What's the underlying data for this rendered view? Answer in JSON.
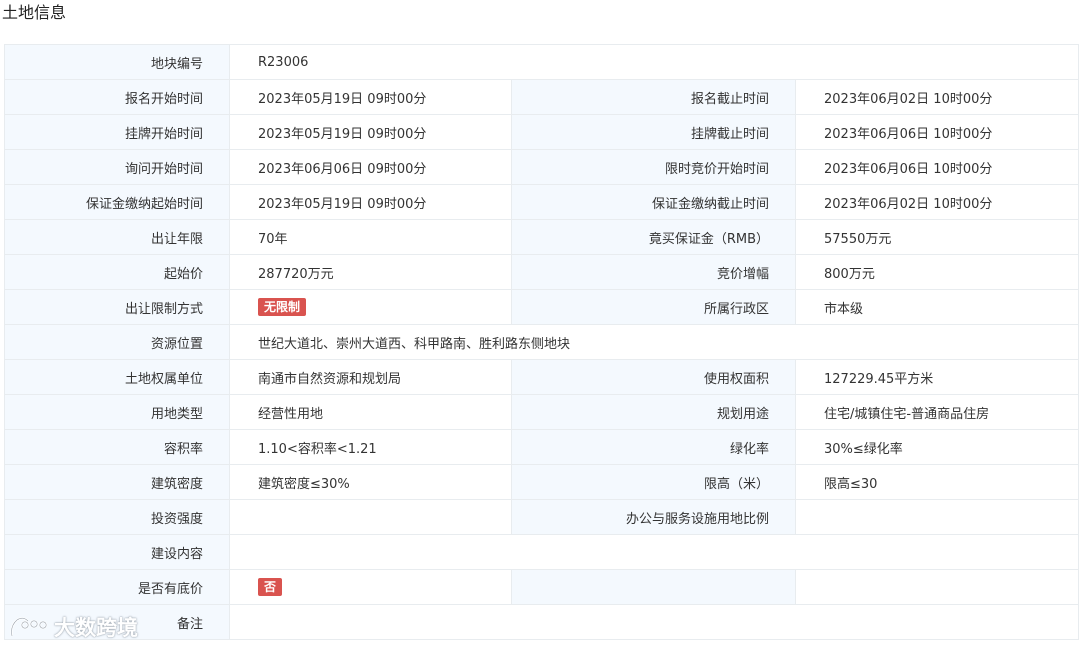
{
  "page": {
    "title": "土地信息"
  },
  "rows": [
    {
      "l1": "地块编号",
      "v1": "R23006"
    },
    {
      "l1": "报名开始时间",
      "v1": "2023年05月19日 09时00分",
      "l2": "报名截止时间",
      "v2": "2023年06月02日 10时00分"
    },
    {
      "l1": "挂牌开始时间",
      "v1": "2023年05月19日 09时00分",
      "l2": "挂牌截止时间",
      "v2": "2023年06月06日 10时00分"
    },
    {
      "l1": "询问开始时间",
      "v1": "2023年06月06日 09时00分",
      "l2": "限时竞价开始时间",
      "v2": "2023年06月06日 10时00分"
    },
    {
      "l1": "保证金缴纳起始时间",
      "v1": "2023年05月19日 09时00分",
      "l2": "保证金缴纳截止时间",
      "v2": "2023年06月02日 10时00分"
    },
    {
      "l1": "出让年限",
      "v1": "70年",
      "l2": "竟买保证金（RMB）",
      "v2": "57550万元"
    },
    {
      "l1": "起始价",
      "v1": "287720万元",
      "l2": "竞价增幅",
      "v2": "800万元"
    },
    {
      "l1": "出让限制方式",
      "v1": "无限制",
      "l2": "所属行政区",
      "v2": "市本级"
    },
    {
      "l1": "资源位置",
      "v1": "世纪大道北、崇州大道西、科甲路南、胜利路东侧地块"
    },
    {
      "l1": "土地权属单位",
      "v1": "南通市自然资源和规划局",
      "l2": "使用权面积",
      "v2": "127229.45平方米"
    },
    {
      "l1": "用地类型",
      "v1": "经营性用地",
      "l2": "规划用途",
      "v2": "住宅/城镇住宅-普通商品住房"
    },
    {
      "l1": "容积率",
      "v1": "1.10<容积率<1.21",
      "l2": "绿化率",
      "v2": "30%≤绿化率"
    },
    {
      "l1": "建筑密度",
      "v1": "建筑密度≤30%",
      "l2": "限高（米）",
      "v2": "限高≤30"
    },
    {
      "l1": "投资强度",
      "v1": "",
      "l2": "办公与服务设施用地比例",
      "v2": ""
    },
    {
      "l1": "建设内容",
      "v1": ""
    },
    {
      "l1": "是否有底价",
      "v1": "否"
    },
    {
      "l1": "备注",
      "v1": ""
    }
  ],
  "watermark": {
    "text": "大数跨境",
    "icon": "dashujujing-logo-icon"
  },
  "colors": {
    "label_bg": "#f4f9fe",
    "border": "#e8ecef",
    "badge": "#d9534f"
  }
}
